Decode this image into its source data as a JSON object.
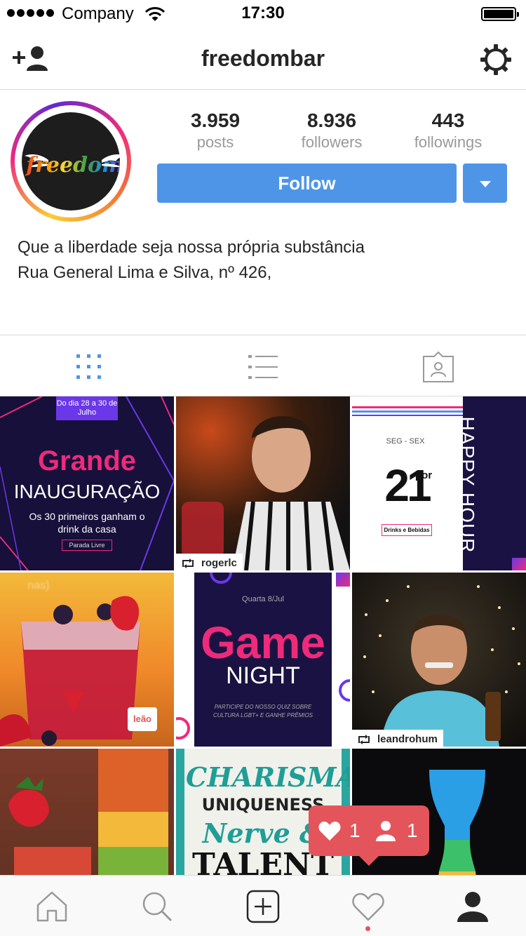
{
  "status_bar": {
    "carrier": "Company",
    "time": "17:30"
  },
  "nav": {
    "title": "freedombar",
    "icons": [
      "add-user-icon",
      "settings-icon"
    ]
  },
  "profile": {
    "avatar_text": "freedom",
    "stats": [
      {
        "value": "3.959",
        "label": "posts"
      },
      {
        "value": "8.936",
        "label": "followers"
      },
      {
        "value": "443",
        "label": "followings"
      }
    ],
    "follow_label": "Follow",
    "bio": [
      "Que a liberdade seja nossa própria substância",
      "Rua General Lima e Silva, nº 426,"
    ]
  },
  "view_tabs": [
    "grid-view-icon",
    "list-view-icon",
    "tagged-photos-icon"
  ],
  "posts": [
    {
      "badge": "Do dia 28 a 30 de Julho",
      "title": "Grande",
      "subtitle": "INAUGURAÇÃO",
      "line": "Os 30 primeiros ganham o drink da casa",
      "tag": "Parada Livre"
    },
    {
      "repost_user": "rogerlc"
    },
    {
      "small": "SEG - SEX",
      "big": "21",
      "sup": "por",
      "box": "Drinks e Bebidas",
      "vertical": "HAPPY HOUR"
    },
    {
      "fade_text": "nas)",
      "brand": "leão"
    },
    {
      "date": "Quarta 8/Jul",
      "title": "Game",
      "subtitle": "NIGHT",
      "line": "PARTICIPE DO NOSSO QUIZ SOBRE CULTURA LGBT+ E GANHE PRÊMIOS"
    },
    {
      "repost_user": "leandrohum"
    },
    {},
    {
      "words": [
        "CHARISMA",
        "UNIQUENESS",
        "Nerve &",
        "TALENT"
      ]
    },
    {}
  ],
  "notification": {
    "likes": "1",
    "followers": "1"
  },
  "tab_bar": [
    "home-icon",
    "search-icon",
    "new-post-icon",
    "activity-icon",
    "profile-icon"
  ],
  "colors": {
    "accent": "#4e95e8",
    "notification": "#e4555b",
    "pink": "#ee2a7b",
    "border": "#dbdbdb"
  }
}
